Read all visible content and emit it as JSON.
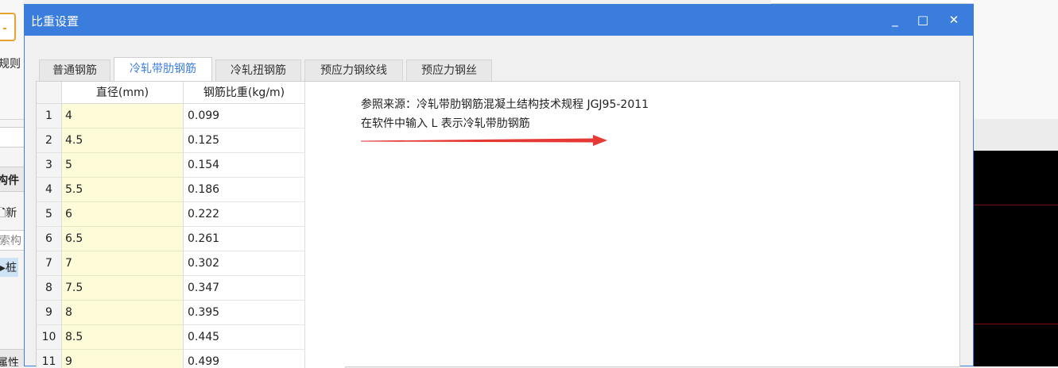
{
  "background": {
    "ribbon_label": "规则",
    "panel_title": "构件",
    "new_label": "新",
    "search_placeholder": "索构",
    "tree_item": "桩",
    "footer_label": "属性"
  },
  "dialog": {
    "title": "比重设置",
    "controls": {
      "minimize": "_",
      "maximize": "□",
      "close": "✕"
    },
    "tabs": [
      {
        "label": "普通钢筋"
      },
      {
        "label": "冷轧带肋钢筋"
      },
      {
        "label": "冷轧扭钢筋"
      },
      {
        "label": "预应力钢绞线"
      },
      {
        "label": "预应力钢丝"
      }
    ],
    "active_tab": 1,
    "grid": {
      "headers": {
        "diameter": "直径(mm)",
        "weight": "钢筋比重(kg/m)"
      },
      "rows": [
        {
          "index": "1",
          "diameter": "4",
          "weight": "0.099"
        },
        {
          "index": "2",
          "diameter": "4.5",
          "weight": "0.125"
        },
        {
          "index": "3",
          "diameter": "5",
          "weight": "0.154"
        },
        {
          "index": "4",
          "diameter": "5.5",
          "weight": "0.186"
        },
        {
          "index": "5",
          "diameter": "6",
          "weight": "0.222"
        },
        {
          "index": "6",
          "diameter": "6.5",
          "weight": "0.261"
        },
        {
          "index": "7",
          "diameter": "7",
          "weight": "0.302"
        },
        {
          "index": "8",
          "diameter": "7.5",
          "weight": "0.347"
        },
        {
          "index": "9",
          "diameter": "8",
          "weight": "0.395"
        },
        {
          "index": "10",
          "diameter": "8.5",
          "weight": "0.445"
        },
        {
          "index": "11",
          "diameter": "9",
          "weight": "0.499"
        }
      ]
    },
    "info": {
      "line1": "参照来源：冷轧带肋钢筋混凝土结构技术规程 JGJ95-2011",
      "line2": "在软件中输入 L 表示冷轧带肋钢筋"
    },
    "colors": {
      "titlebar": "#3b7ddd",
      "active_tab_text": "#3b7ddd",
      "diameter_cell": "#fefbd9",
      "arrow": "#e53935"
    }
  }
}
